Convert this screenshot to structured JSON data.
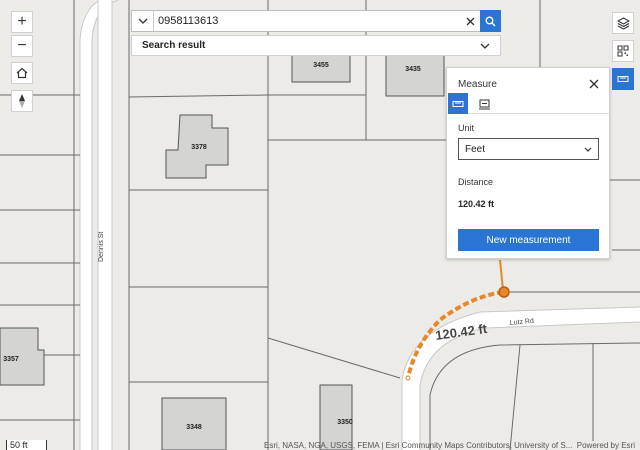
{
  "search": {
    "value": "0958113613",
    "result_label": "Search result"
  },
  "parcels": [
    "3455",
    "3435",
    "3378",
    "3357",
    "3348",
    "3350"
  ],
  "streets": {
    "dennis": "Dennis St",
    "lutz": "Lutz Rd"
  },
  "measurement_label": "120.42 ft",
  "measure_panel": {
    "title": "Measure",
    "unit_label": "Unit",
    "unit_value": "Feet",
    "distance_label": "Distance",
    "distance_value": "120.42 ft",
    "new_button": "New measurement"
  },
  "scale_label": "50 ft",
  "attribution": "Esri, NASA, NGA, USGS, FEMA | Esri Community Maps Contributors, University of S...",
  "powered_by": "Powered by Esri",
  "colors": {
    "accent": "#2a74d4",
    "measure_line": "#e8862a",
    "building": "#cfcfcf",
    "road": "#ffffff",
    "ground": "#ecebe7"
  }
}
